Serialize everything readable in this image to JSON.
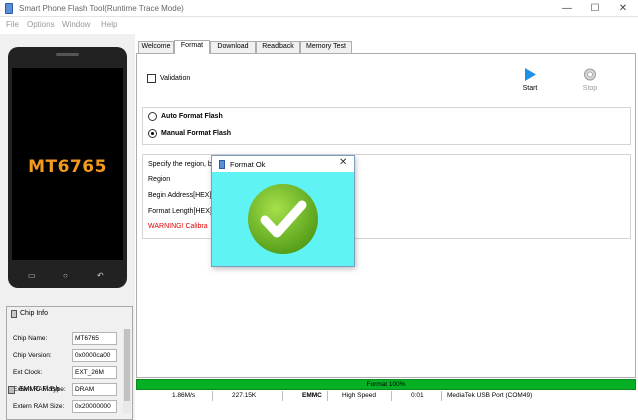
{
  "window": {
    "title": "Smart Phone Flash Tool(Runtime Trace Mode)"
  },
  "menu": [
    "File",
    "Options",
    "Window",
    "Help"
  ],
  "phone": {
    "chip_label": "MT6765"
  },
  "chip_info": {
    "title": "Chip Info",
    "rows": [
      {
        "label": "Chip Name:",
        "value": "MT6765"
      },
      {
        "label": "Chip Version:",
        "value": "0x0000ca00"
      },
      {
        "label": "Ext Clock:",
        "value": "EXT_26M"
      },
      {
        "label": "Extern RAM Type:",
        "value": "DRAM"
      },
      {
        "label": "Extern RAM Size:",
        "value": "0x20000000"
      }
    ],
    "storage_item": "EMMC Flash"
  },
  "tabs": [
    {
      "label": "Welcome",
      "active": false
    },
    {
      "label": "Format",
      "active": true
    },
    {
      "label": "Download",
      "active": false
    },
    {
      "label": "Readback",
      "active": false
    },
    {
      "label": "Memory Test",
      "active": false
    }
  ],
  "format_tab": {
    "validation_label": "Validation",
    "validation_checked": false,
    "start_label": "Start",
    "stop_label": "Stop",
    "auto_format_label": "Auto Format Flash",
    "manual_format_label": "Manual Format Flash",
    "selected_mode": "manual",
    "manual_area": {
      "line1": "Specify the region, be",
      "line2": "Region",
      "line3": "Begin Address[HEX]:",
      "line4": "Format Length[HEX]:",
      "warning": "WARNING!  Calibra"
    }
  },
  "dialog": {
    "title": "Format Ok",
    "close_glyph": "✕"
  },
  "status": {
    "progress_text": "Format 100%",
    "progress_fraction": 1.0,
    "speed": "1.86M/s",
    "size": "227.15K",
    "storage": "EMMC",
    "usb_speed": "High Speed",
    "time": "0:01",
    "port": "MediaTek USB Port (COM49)"
  },
  "colors": {
    "progress": "#06b025",
    "dialog_body": "#5ff3f3",
    "chip_text": "#f29a1b",
    "warning": "#e00000",
    "start_icon": "#1e90e8",
    "check_circle": "#7ac52a"
  }
}
